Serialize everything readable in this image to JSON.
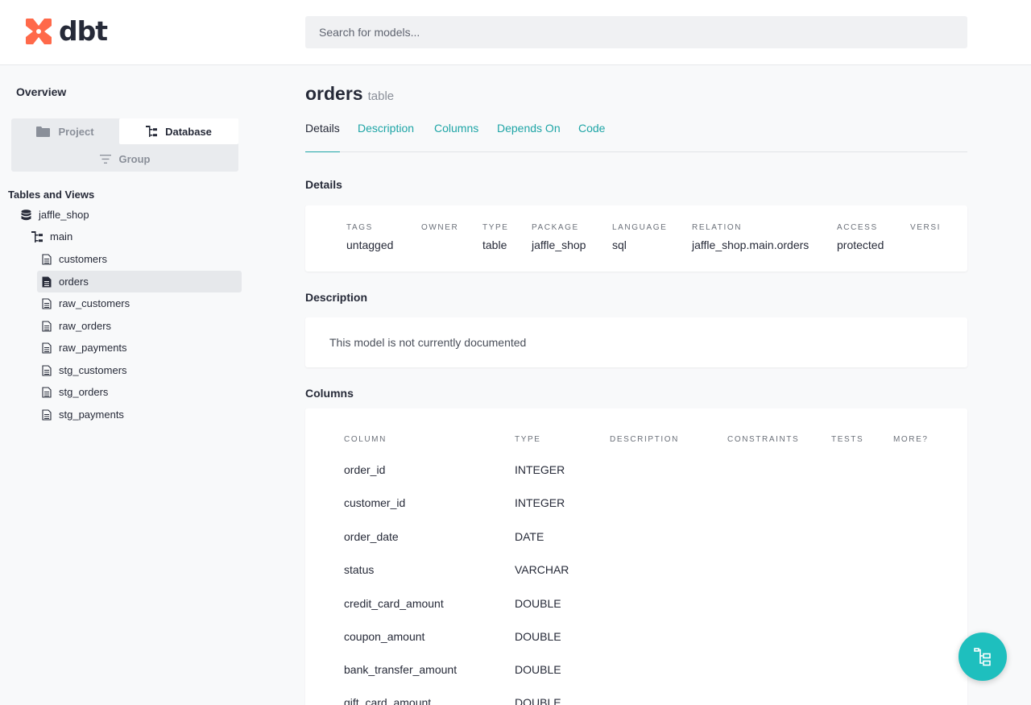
{
  "header": {
    "logo_text": "dbt",
    "search_placeholder": "Search for models..."
  },
  "sidebar": {
    "overview": "Overview",
    "switcher": {
      "project": "Project",
      "database": "Database",
      "group": "Group",
      "active": "Database"
    },
    "section_label": "Tables and Views",
    "database": "jaffle_shop",
    "schema": "main",
    "models": [
      "customers",
      "orders",
      "raw_customers",
      "raw_orders",
      "raw_payments",
      "stg_customers",
      "stg_orders",
      "stg_payments"
    ],
    "selected_model": "orders"
  },
  "main": {
    "title": "orders",
    "type_label": "table",
    "tabs": [
      "Details",
      "Description",
      "Columns",
      "Depends On",
      "Code"
    ],
    "active_tab": "Details",
    "details": {
      "heading": "Details",
      "fields": [
        {
          "label": "TAGS",
          "value": "untagged"
        },
        {
          "label": "OWNER",
          "value": ""
        },
        {
          "label": "TYPE",
          "value": "table"
        },
        {
          "label": "PACKAGE",
          "value": "jaffle_shop"
        },
        {
          "label": "LANGUAGE",
          "value": "sql"
        },
        {
          "label": "RELATION",
          "value": "jaffle_shop.main.orders"
        },
        {
          "label": "ACCESS",
          "value": "protected"
        },
        {
          "label": "VERSI",
          "value": ""
        }
      ]
    },
    "description": {
      "heading": "Description",
      "text": "This model is not currently documented"
    },
    "columns": {
      "heading": "Columns",
      "headers": [
        "COLUMN",
        "TYPE",
        "DESCRIPTION",
        "CONSTRAINTS",
        "TESTS",
        "MORE?"
      ],
      "rows": [
        {
          "name": "order_id",
          "type": "INTEGER"
        },
        {
          "name": "customer_id",
          "type": "INTEGER"
        },
        {
          "name": "order_date",
          "type": "DATE"
        },
        {
          "name": "status",
          "type": "VARCHAR"
        },
        {
          "name": "credit_card_amount",
          "type": "DOUBLE"
        },
        {
          "name": "coupon_amount",
          "type": "DOUBLE"
        },
        {
          "name": "bank_transfer_amount",
          "type": "DOUBLE"
        },
        {
          "name": "gift_card_amount",
          "type": "DOUBLE"
        }
      ]
    }
  },
  "fab": {
    "icon": "lineage-graph-icon"
  },
  "colors": {
    "accent": "#1ebfbe",
    "link": "#1ea5a6",
    "brand": "#ff694a",
    "text": "#262a38"
  }
}
